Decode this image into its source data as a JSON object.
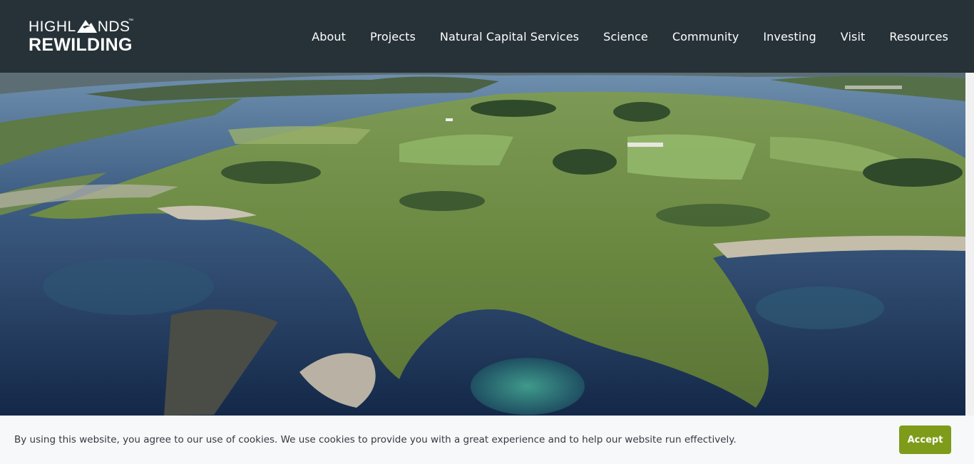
{
  "header": {
    "logo": {
      "line1_a": "HIGHL",
      "line1_b": "NDS",
      "trademark": "™",
      "line2": "REWILDING"
    },
    "nav": [
      {
        "label": "About"
      },
      {
        "label": "Projects"
      },
      {
        "label": "Natural Capital Services"
      },
      {
        "label": "Science"
      },
      {
        "label": "Community"
      },
      {
        "label": "Investing"
      },
      {
        "label": "Visit"
      },
      {
        "label": "Resources"
      }
    ]
  },
  "hero": {
    "image": "aerial-coastal-landscape"
  },
  "cookie_banner": {
    "message": "By using this website, you agree to our use of cookies. We use cookies to provide you with a great experience and to help our website run effectively.",
    "accept_label": "Accept"
  },
  "colors": {
    "header_bg": "#263238",
    "accent_green": "#7e9b1a",
    "cookie_bg": "#f7f8fa"
  }
}
